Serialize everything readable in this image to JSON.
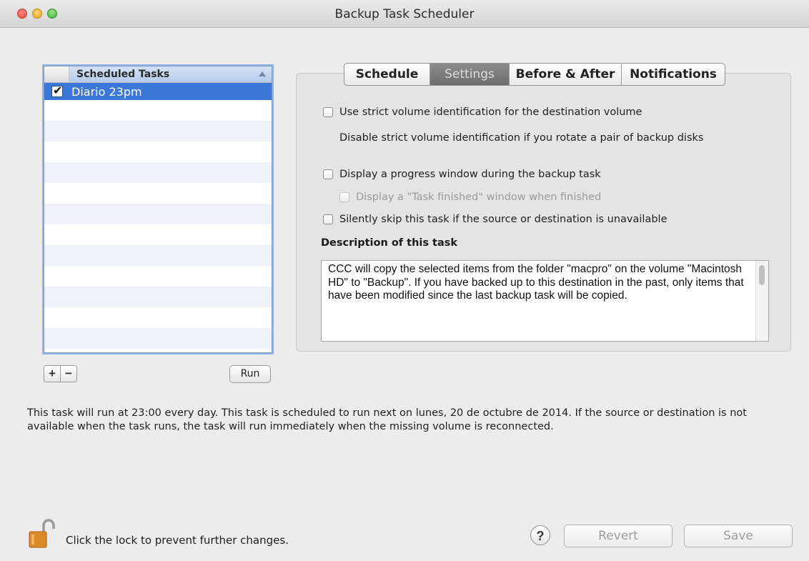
{
  "window": {
    "title": "Backup Task Scheduler"
  },
  "task_list": {
    "header": "Scheduled Tasks",
    "tasks": [
      {
        "name": "Diario 23pm",
        "checked": true,
        "selected": true
      }
    ],
    "add_label": "+",
    "remove_label": "−",
    "run_label": "Run"
  },
  "tabs": [
    {
      "label": "Schedule",
      "active": false
    },
    {
      "label": "Settings",
      "active": true
    },
    {
      "label": "Before & After",
      "active": false
    },
    {
      "label": "Notifications",
      "active": false
    }
  ],
  "settings": {
    "strict_volume": "Use strict volume identification for the destination volume",
    "strict_volume_note": "Disable strict volume identification if you rotate a pair of backup disks",
    "progress_window": "Display a progress window during the backup task",
    "task_finished": "Display a \"Task finished\" window when finished",
    "skip_unavailable": "Silently skip this task if the source or destination is unavailable",
    "description_heading": "Description of this task",
    "description_text": "CCC will copy the selected items from the folder \"macpro\" on the volume \"Macintosh HD\" to \"Backup\". If you have backed up to this destination in the past, only items that have been modified since the last backup task will be copied."
  },
  "summary": "This task will run at 23:00 every day. This task is scheduled to run next on lunes, 20 de octubre de 2014. If the source or destination is not available when the task runs, the task will run immediately when the missing volume is reconnected.",
  "footer": {
    "lock_text": "Click the lock to prevent further changes.",
    "help_label": "?",
    "revert_label": "Revert",
    "save_label": "Save"
  },
  "colors": {
    "selection": "#3c78d8",
    "active_tab": "#7a7a7a"
  }
}
